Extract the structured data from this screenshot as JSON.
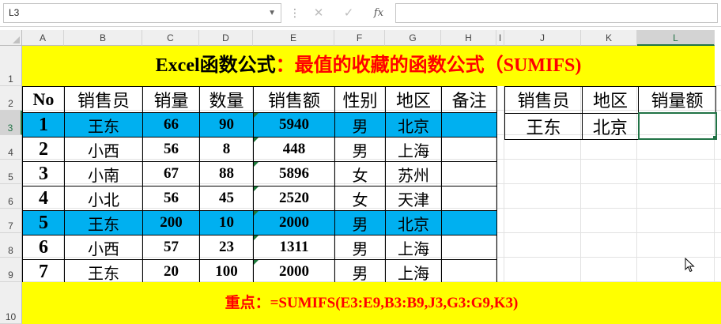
{
  "formula_bar": {
    "name_box": "L3",
    "dots": "⋮",
    "cancel": "✕",
    "enter": "✓",
    "fx": "fx",
    "formula": ""
  },
  "columns": [
    {
      "label": "A"
    },
    {
      "label": "B"
    },
    {
      "label": "C"
    },
    {
      "label": "D"
    },
    {
      "label": "E"
    },
    {
      "label": "F"
    },
    {
      "label": "G"
    },
    {
      "label": "H"
    },
    {
      "label": "I"
    },
    {
      "label": "J"
    },
    {
      "label": "K"
    },
    {
      "label": "L"
    }
  ],
  "rows": [
    "1",
    "2",
    "3",
    "4",
    "5",
    "6",
    "7",
    "8",
    "9",
    "10"
  ],
  "title": {
    "part1": "Excel函数公式",
    "part2": "：最值的收藏的函数公式（SUMIFS)"
  },
  "table": {
    "headers": [
      "No",
      "销售员",
      "销量",
      "数量",
      "销售额",
      "性别",
      "地区",
      "备注"
    ],
    "rows": [
      [
        "1",
        "王东",
        "66",
        "90",
        "5940",
        "男",
        "北京",
        ""
      ],
      [
        "2",
        "小西",
        "56",
        "8",
        "448",
        "男",
        "上海",
        ""
      ],
      [
        "3",
        "小南",
        "67",
        "88",
        "5896",
        "女",
        "苏州",
        ""
      ],
      [
        "4",
        "小北",
        "56",
        "45",
        "2520",
        "女",
        "天津",
        ""
      ],
      [
        "5",
        "王东",
        "200",
        "10",
        "2000",
        "男",
        "北京",
        ""
      ],
      [
        "6",
        "小西",
        "57",
        "23",
        "1311",
        "男",
        "上海",
        ""
      ],
      [
        "7",
        "王东",
        "20",
        "100",
        "2000",
        "男",
        "上海",
        ""
      ]
    ]
  },
  "side_table": {
    "headers": [
      "销售员",
      "地区",
      "销量额"
    ],
    "values": [
      "王东",
      "北京",
      ""
    ]
  },
  "footer": {
    "label": "重点：",
    "formula": "=SUMIFS(E3:E9,B3:B9,J3,G3:G9,K3)"
  },
  "colors": {
    "banner": "#ffff00",
    "highlight_row": "#00b0f0",
    "title_red": "#ff0000",
    "selection_green": "#217346"
  }
}
